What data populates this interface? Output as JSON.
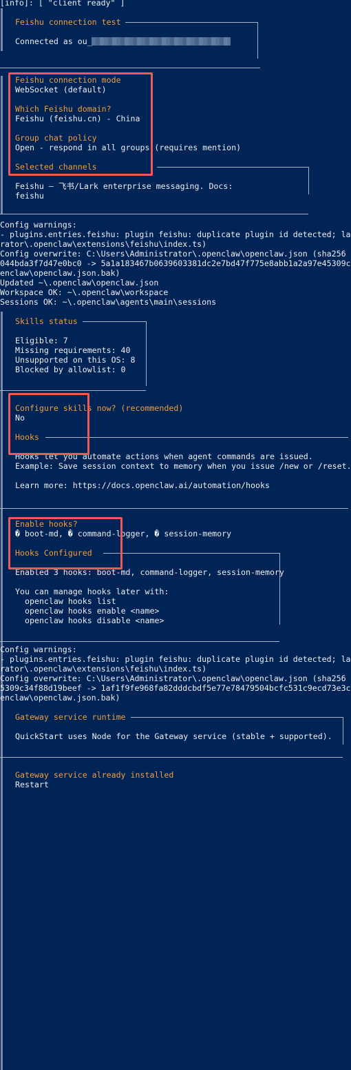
{
  "top": {
    "line": "[info]: [ \"client ready\" ]"
  },
  "feishu_test": {
    "title": "Feishu connection test",
    "connected": "Connected as ou_"
  },
  "mode": {
    "title": "Feishu connection mode",
    "value": "WebSocket (default)"
  },
  "domain": {
    "title": "Which Feishu domain?",
    "value": "Feishu (feishu.cn) - China"
  },
  "group_policy": {
    "title": "Group chat policy",
    "value": "Open - respond in all groups (requires mention)"
  },
  "channels": {
    "title": "Selected channels",
    "line1": "Feishu — 飞书/Lark enterprise messaging. Docs:",
    "line2": "feishu"
  },
  "warnings1": {
    "lines": [
      "Config warnings:",
      "- plugins.entries.feishu: plugin feishu: duplicate plugin id detected; la",
      "rator\\.openclaw\\extensions\\feishu\\index.ts)",
      "Config overwrite: C:\\Users\\Administrator\\.openclaw\\openclaw.json (sha256",
      "044bda3f7d47e0bc0 -> 5a1a183467b0639603381dc2e7bd47f775e8abb1a2a97e45309c",
      "enclaw\\openclaw.json.bak)",
      "Updated ~\\.openclaw\\openclaw.json",
      "Workspace OK: ~\\.openclaw\\workspace",
      "Sessions OK: ~\\.openclaw\\agents\\main\\sessions"
    ]
  },
  "skills": {
    "title": "Skills status",
    "lines": [
      "Eligible: 7",
      "Missing requirements: 40",
      "Unsupported on this OS: 8",
      "Blocked by allowlist: 0"
    ]
  },
  "configure_skills": {
    "title": "Configure skills now? (recommended)",
    "value": "No"
  },
  "hooks": {
    "title": "Hooks",
    "line1": "Hooks let you automate actions when agent commands are issued.",
    "line2": "Example: Save session context to memory when you issue /new or /reset.",
    "line3": "Learn more: https://docs.openclaw.ai/automation/hooks"
  },
  "enable_hooks": {
    "title": "Enable hooks?",
    "value": "� boot-md, � command-logger, � session-memory"
  },
  "hooks_configured": {
    "title": "Hooks Configured",
    "line1": "Enabled 3 hooks: boot-md, command-logger, session-memory",
    "line2": "You can manage hooks later with:",
    "cmds": [
      "openclaw hooks list",
      "openclaw hooks enable <name>",
      "openclaw hooks disable <name>"
    ]
  },
  "warnings2": {
    "lines": [
      "Config warnings:",
      "- plugins.entries.feishu: plugin feishu: duplicate plugin id detected; la",
      "rator\\.openclaw\\extensions\\feishu\\index.ts)",
      "Config overwrite: C:\\Users\\Administrator\\.openclaw\\openclaw.json (sha256",
      "5309c34f88d19beef -> 1af1f9fe968fa82dddcbdf5e77e78479504bcfc531c9ecd73e3c",
      "enclaw\\openclaw.json.bak)"
    ]
  },
  "gateway_runtime": {
    "title": "Gateway service runtime",
    "line": "QuickStart uses Node for the Gateway service (stable + supported)."
  },
  "gateway_installed": {
    "title": "Gateway service already installed",
    "value": "Restart"
  },
  "colors": {
    "background": "#012456",
    "header": "#f39c3c",
    "highlight": "#ee5a5a",
    "text": "#eeedf0"
  }
}
